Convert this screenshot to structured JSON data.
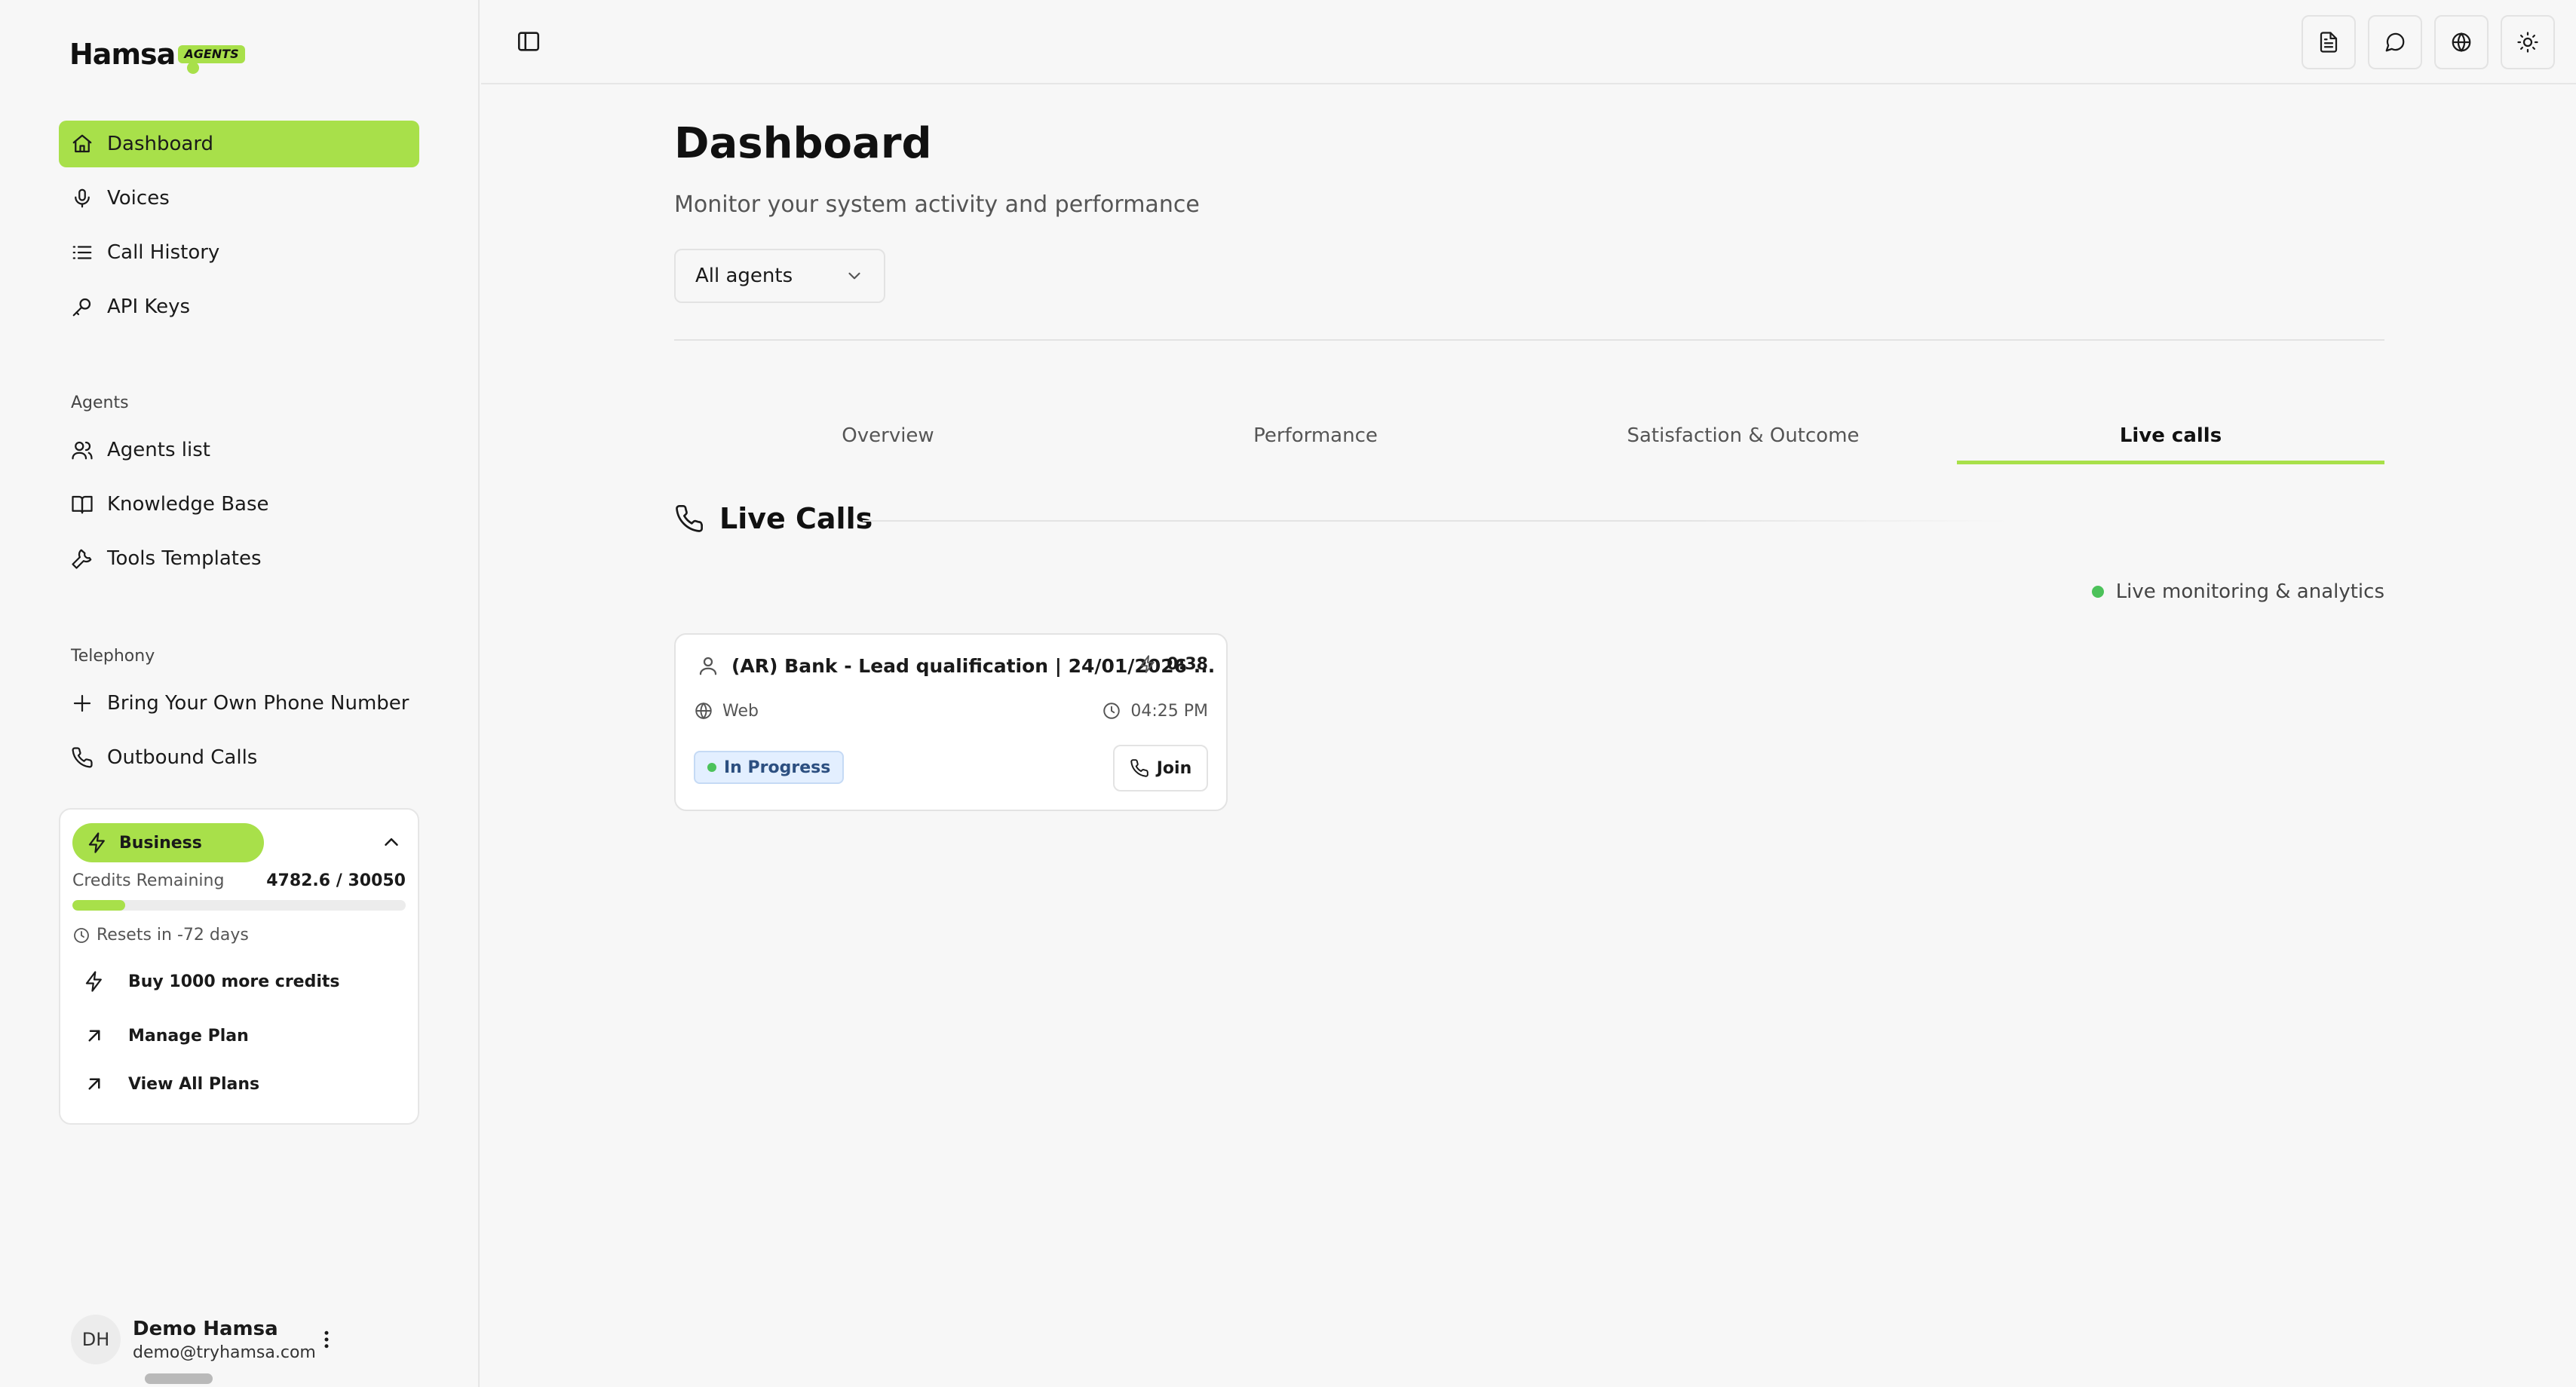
{
  "brand": {
    "name": "Hamsa",
    "badge": "AGENTS"
  },
  "sidebar": {
    "main_items": [
      {
        "label": "Dashboard",
        "icon": "home-icon",
        "active": true
      },
      {
        "label": "Voices",
        "icon": "microphone-icon"
      },
      {
        "label": "Call History",
        "icon": "list-icon"
      },
      {
        "label": "API Keys",
        "icon": "key-icon"
      }
    ],
    "agents_section": "Agents",
    "agents_items": [
      {
        "label": "Agents list",
        "icon": "users-icon"
      },
      {
        "label": "Knowledge Base",
        "icon": "book-icon"
      },
      {
        "label": "Tools Templates",
        "icon": "wrench-icon"
      }
    ],
    "telephony_section": "Telephony",
    "telephony_items": [
      {
        "label": "Bring Your Own Phone Number",
        "icon": "plus-icon"
      },
      {
        "label": "Outbound Calls",
        "icon": "phone-icon"
      }
    ]
  },
  "plan": {
    "name": "Business",
    "credits_label": "Credits Remaining",
    "credits_value": "4782.6 / 30050",
    "credits_fraction": 0.159,
    "resets": "Resets in -72 days",
    "actions": [
      {
        "label": "Buy 1000 more credits",
        "icon": "lightning-icon"
      },
      {
        "label": "Manage Plan",
        "icon": "arrow-up-right-icon"
      },
      {
        "label": "View All Plans",
        "icon": "arrow-up-right-icon"
      }
    ]
  },
  "user": {
    "initials": "DH",
    "name": "Demo Hamsa",
    "email": "demo@tryhamsa.com"
  },
  "header": {
    "title": "Dashboard",
    "subtitle": "Monitor your system activity and performance",
    "agent_filter": "All agents"
  },
  "tabs": [
    {
      "label": "Overview"
    },
    {
      "label": "Performance"
    },
    {
      "label": "Satisfaction & Outcome"
    },
    {
      "label": "Live calls",
      "active": true
    }
  ],
  "live": {
    "section_title": "Live Calls",
    "monitoring_label": "Live monitoring & analytics",
    "calls": [
      {
        "title": "(AR) Bank - Lead qualification | 24/01/2026 ...",
        "duration": "0:38",
        "channel": "Web",
        "time": "04:25 PM",
        "status": "In Progress",
        "join_label": "Join"
      }
    ]
  },
  "colors": {
    "accent": "#a8e04a",
    "status_green": "#4cc25a",
    "badge_blue": "#e3efff"
  }
}
